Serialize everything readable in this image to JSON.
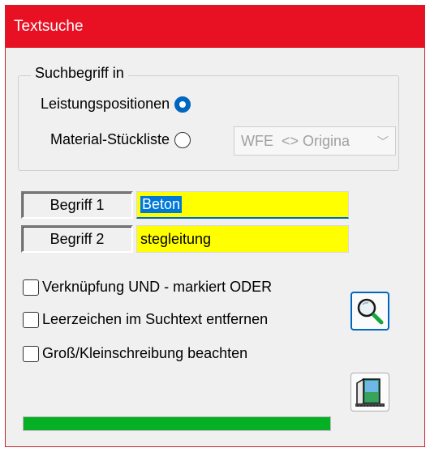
{
  "window": {
    "title": "Textsuche",
    "accent": "#e81123"
  },
  "search_scope": {
    "legend": "Suchbegriff in",
    "option_positions": {
      "label": "Leistungspositionen",
      "selected": true
    },
    "option_materials": {
      "label": "Material-Stückliste",
      "selected": false
    },
    "material_combo": {
      "value": "WFE  <> Origina",
      "enabled": false
    }
  },
  "terms": [
    {
      "label": "Begriff 1",
      "value": "Beton"
    },
    {
      "label": "Begriff 2",
      "value": "stegleitung"
    }
  ],
  "options": [
    {
      "label": "Verknüpfung UND - markiert ODER",
      "checked": false
    },
    {
      "label": "Leerzeichen im Suchtext entfernen",
      "checked": false
    },
    {
      "label": "Groß/Kleinschreibung beachten",
      "checked": false
    }
  ],
  "buttons": {
    "search_icon": "magnifier-icon",
    "exit_icon": "exit-door-icon"
  },
  "progress": {
    "value": 1.0,
    "color": "#06b025"
  }
}
